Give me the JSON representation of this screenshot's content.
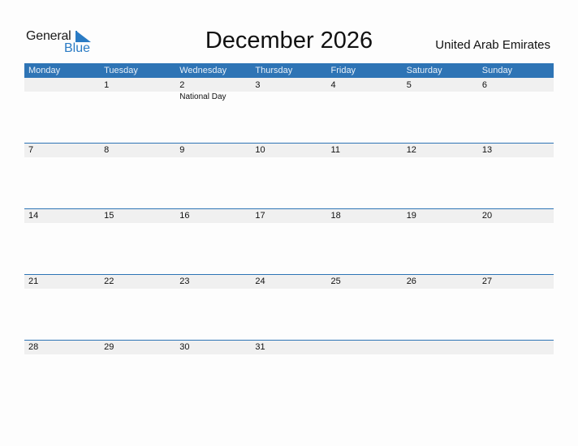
{
  "logo": {
    "line1": "General",
    "line2": "Blue",
    "accent_color": "#2a7bc4"
  },
  "title": "December 2026",
  "country": "United Arab Emirates",
  "header_color": "#2e74b5",
  "weekdays": [
    "Monday",
    "Tuesday",
    "Wednesday",
    "Thursday",
    "Friday",
    "Saturday",
    "Sunday"
  ],
  "weeks": [
    [
      {
        "day": ""
      },
      {
        "day": "1"
      },
      {
        "day": "2",
        "holiday": "National Day"
      },
      {
        "day": "3"
      },
      {
        "day": "4"
      },
      {
        "day": "5"
      },
      {
        "day": "6"
      }
    ],
    [
      {
        "day": "7"
      },
      {
        "day": "8"
      },
      {
        "day": "9"
      },
      {
        "day": "10"
      },
      {
        "day": "11"
      },
      {
        "day": "12"
      },
      {
        "day": "13"
      }
    ],
    [
      {
        "day": "14"
      },
      {
        "day": "15"
      },
      {
        "day": "16"
      },
      {
        "day": "17"
      },
      {
        "day": "18"
      },
      {
        "day": "19"
      },
      {
        "day": "20"
      }
    ],
    [
      {
        "day": "21"
      },
      {
        "day": "22"
      },
      {
        "day": "23"
      },
      {
        "day": "24"
      },
      {
        "day": "25"
      },
      {
        "day": "26"
      },
      {
        "day": "27"
      }
    ],
    [
      {
        "day": "28"
      },
      {
        "day": "29"
      },
      {
        "day": "30"
      },
      {
        "day": "31"
      },
      {
        "day": ""
      },
      {
        "day": ""
      },
      {
        "day": ""
      }
    ]
  ]
}
